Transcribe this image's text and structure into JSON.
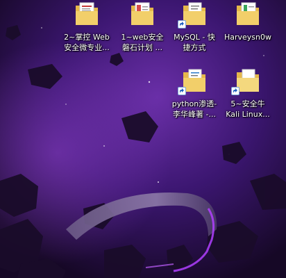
{
  "desktop": {
    "icons": [
      {
        "line1": "2~掌控 Web",
        "line2": "安全微专业...",
        "kind": "folder-docs"
      },
      {
        "line1": "1~web安全",
        "line2": "磐石计划 ...",
        "kind": "folder-docs-red"
      },
      {
        "line1": "MySQL - 快",
        "line2": "捷方式",
        "kind": "folder-shortcut"
      },
      {
        "line1": "Harveysn0w",
        "line2": "",
        "kind": "folder-docs-green"
      },
      {
        "line1": "python渗透-",
        "line2": "李华峰著 -...",
        "kind": "folder-shortcut"
      },
      {
        "line1": "5~安全牛",
        "line2": "Kali Linux...",
        "kind": "folder-shortcut-white"
      }
    ]
  },
  "colors": {
    "sky_top": "#2a0f4a",
    "sky_bottom": "#12081f",
    "ring_glow": "#b040ff",
    "folder": "#f2cf6a"
  }
}
